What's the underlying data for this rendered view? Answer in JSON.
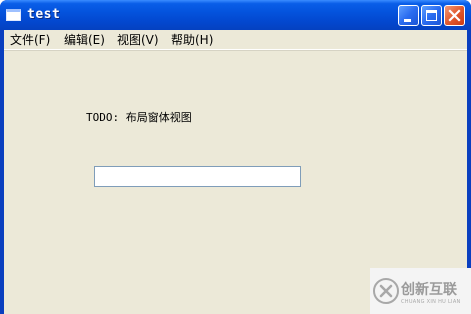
{
  "window": {
    "title": "test",
    "accent_color": "#0a5ee8",
    "icons": [
      "app-window-icon",
      "minimize-icon",
      "maximize-icon",
      "close-icon"
    ]
  },
  "menu": {
    "items": [
      {
        "label": "文件(F)"
      },
      {
        "label": "编辑(E)"
      },
      {
        "label": "视图(V)"
      },
      {
        "label": "帮助(H)"
      }
    ]
  },
  "main": {
    "label": "TODO: 布局窗体视图",
    "input_value": ""
  },
  "watermark": {
    "text": "创新互联",
    "subtext": "CHUANG XIN HU LIAN"
  }
}
